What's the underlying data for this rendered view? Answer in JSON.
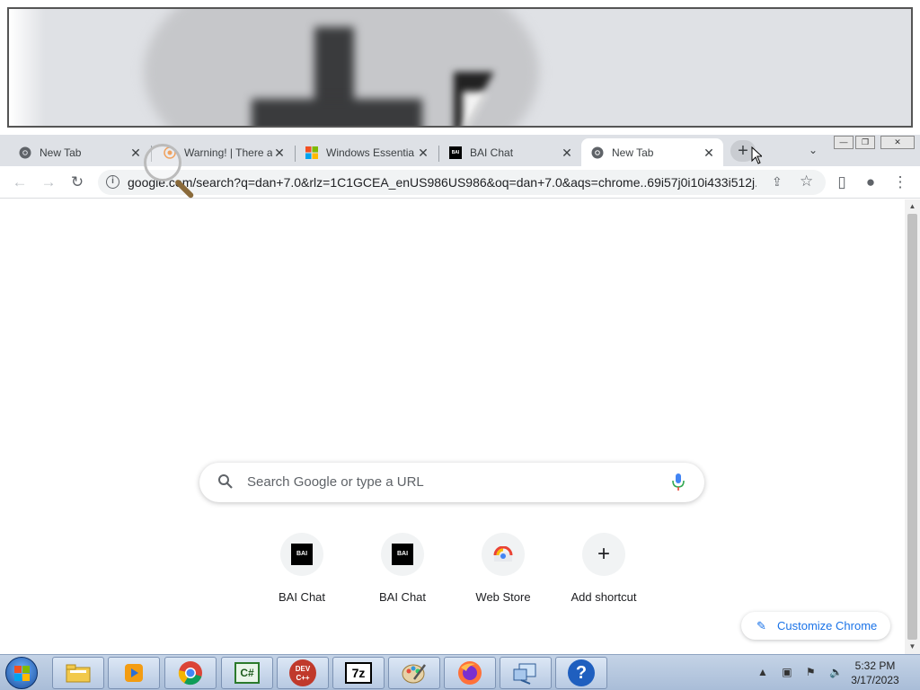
{
  "tabs": [
    {
      "title": "New Tab",
      "favicon": "chrome-icon",
      "active": false
    },
    {
      "title": "Warning! | There a",
      "favicon": "warning-site-icon",
      "active": false
    },
    {
      "title": "Windows Essentia",
      "favicon": "microsoft-icon",
      "active": false
    },
    {
      "title": "BAI Chat",
      "favicon": "bai-icon",
      "active": false
    },
    {
      "title": "New Tab",
      "favicon": "chrome-icon",
      "active": true
    }
  ],
  "tab_close_glyph": "✕",
  "new_tab_glyph": "+",
  "tab_search_glyph": "⌄",
  "window_controls": {
    "minimize": "—",
    "restore": "❐",
    "close": "✕"
  },
  "toolbar": {
    "back": "←",
    "forward": "→",
    "reload": "↻",
    "url": "google.com/search?q=dan+7.0&rlz=1C1GCEA_enUS986US986&oq=dan+7.0&aqs=chrome..69i57j0i10i433i512j...",
    "info_glyph": "i",
    "share_glyph": "⇪",
    "bookmark_glyph": "☆",
    "sidepanel_glyph": "▯",
    "profile_glyph": "●",
    "menu_glyph": "⋮"
  },
  "ntp": {
    "search_placeholder": "Search Google or type a URL",
    "shortcuts": [
      {
        "label": "BAI Chat",
        "icon": "bai-logo",
        "logo_text": "BAI"
      },
      {
        "label": "BAI Chat",
        "icon": "bai-logo",
        "logo_text": "BAI"
      },
      {
        "label": "Web Store",
        "icon": "web-store-icon"
      },
      {
        "label": "Add shortcut",
        "icon": "plus-icon",
        "glyph": "+"
      }
    ],
    "customize_label": "Customize Chrome",
    "customize_glyph": "✎"
  },
  "taskbar": {
    "items": [
      {
        "name": "file-explorer-icon",
        "text": ""
      },
      {
        "name": "media-player-icon",
        "text": ""
      },
      {
        "name": "chrome-icon",
        "text": ""
      },
      {
        "name": "csharp-ide-icon",
        "text": "C#"
      },
      {
        "name": "devcpp-icon",
        "text": "DEV C++"
      },
      {
        "name": "7zip-icon",
        "text": "7z"
      },
      {
        "name": "paint-icon",
        "text": ""
      },
      {
        "name": "firefox-icon",
        "text": ""
      },
      {
        "name": "network-icon",
        "text": ""
      },
      {
        "name": "help-icon",
        "text": "?"
      }
    ],
    "time": "5:32 PM",
    "date": "3/17/2023",
    "tray_glyphs": "▲ ▣ ⚑ 🔈"
  },
  "colors": {
    "tabstrip": "#dee1e6",
    "accent_blue": "#1a73e8",
    "taskbar": "#b7c9e2"
  }
}
